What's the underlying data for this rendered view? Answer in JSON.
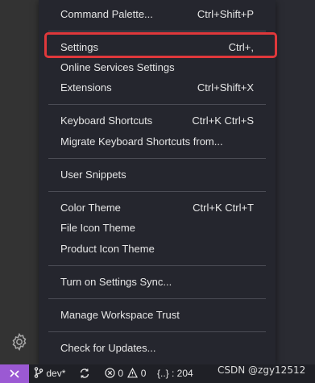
{
  "menu": {
    "items": [
      {
        "label": "Command Palette...",
        "shortcut": "Ctrl+Shift+P"
      },
      {
        "label": "Settings",
        "shortcut": "Ctrl+,"
      },
      {
        "label": "Online Services Settings",
        "shortcut": ""
      },
      {
        "label": "Extensions",
        "shortcut": "Ctrl+Shift+X"
      },
      {
        "label": "Keyboard Shortcuts",
        "shortcut": "Ctrl+K Ctrl+S"
      },
      {
        "label": "Migrate Keyboard Shortcuts from...",
        "shortcut": ""
      },
      {
        "label": "User Snippets",
        "shortcut": ""
      },
      {
        "label": "Color Theme",
        "shortcut": "Ctrl+K Ctrl+T"
      },
      {
        "label": "File Icon Theme",
        "shortcut": ""
      },
      {
        "label": "Product Icon Theme",
        "shortcut": ""
      },
      {
        "label": "Turn on Settings Sync...",
        "shortcut": ""
      },
      {
        "label": "Manage Workspace Trust",
        "shortcut": ""
      },
      {
        "label": "Check for Updates...",
        "shortcut": ""
      }
    ]
  },
  "statusbar": {
    "branch": "dev*",
    "errors": "0",
    "warnings": "0",
    "json_info": "{..} : 204"
  },
  "watermark": "CSDN @zgy12512",
  "colors": {
    "highlight_border": "#e0383b",
    "remote_bg": "#9b59d3",
    "menu_bg": "#25262e"
  },
  "icons": {
    "gear": "gear-icon",
    "remote": "remote-icon",
    "branch": "git-branch-icon",
    "sync": "sync-icon",
    "error": "error-icon",
    "warning": "warning-icon"
  }
}
